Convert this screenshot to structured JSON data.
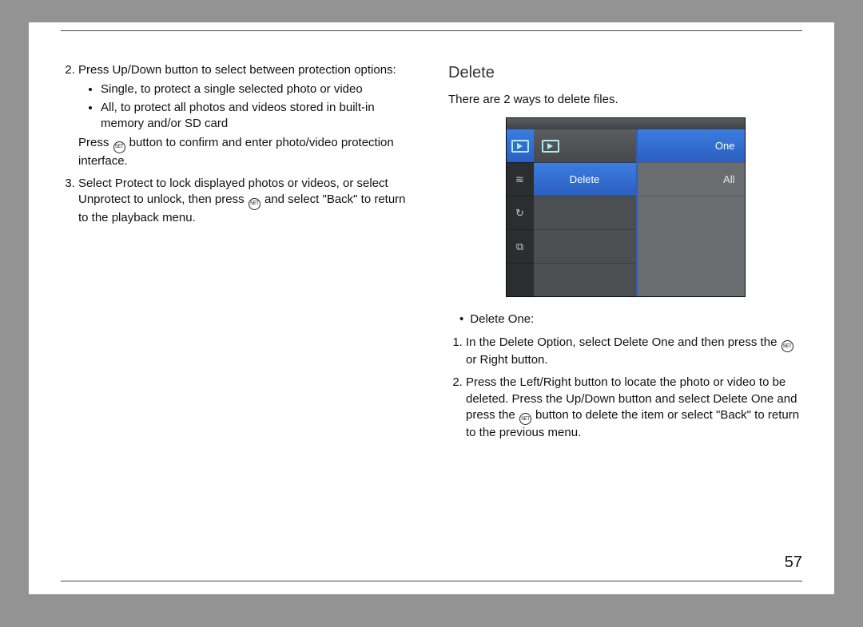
{
  "left": {
    "step2_intro": "Press Up/Down button to select between protection options:",
    "step2_bullets": [
      "Single, to protect a single selected photo or video",
      "All, to protect all photos and videos stored in built-in memory and/or SD card"
    ],
    "step2_after_a": "Press ",
    "step2_after_b": " button to confirm and enter photo/video protection interface.",
    "step3_a": "Select Protect to lock displayed photos or videos, or select Unprotect to unlock, then press ",
    "step3_b": " and select \"Back\" to return to the playback menu."
  },
  "right": {
    "heading": "Delete",
    "intro": "There are 2 ways to delete files.",
    "screenshot": {
      "mid_label": "Delete",
      "opt_one": "One",
      "opt_all": "All"
    },
    "bullet_label": "Delete One:",
    "step1_a": "In the Delete Option, select Delete One and then press the ",
    "step1_b": " or Right button.",
    "step2_a": "Press the Left/Right button to locate the photo or video to be deleted. Press the Up/Down button and select Delete One and press the ",
    "step2_b": " button to delete the item or select \"Back\" to return to the previous menu."
  },
  "set_label": "SET",
  "page_number": "57"
}
